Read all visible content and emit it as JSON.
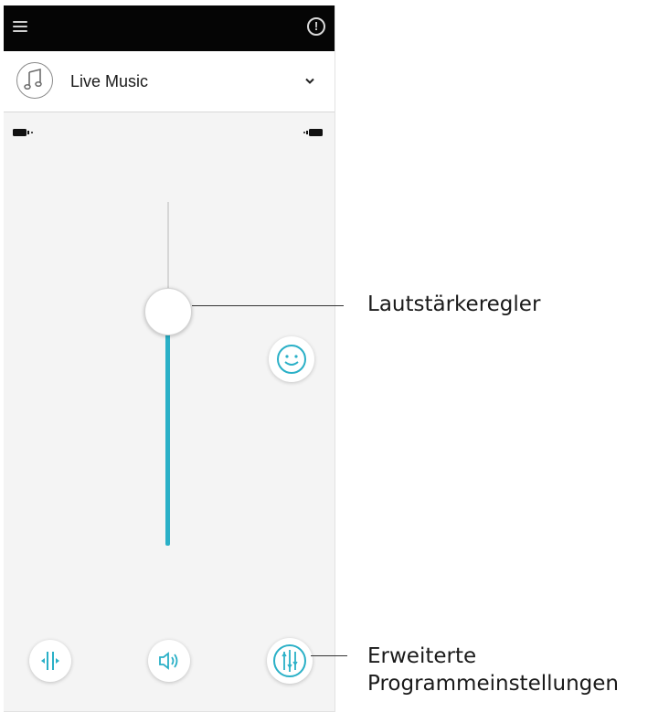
{
  "program": {
    "name": "Live Music"
  },
  "volume": {
    "level": 0.68
  },
  "icons": {
    "menu": "hamburger-menu-icon",
    "alert": "alert-icon",
    "program": "music-note-icon",
    "dropdown": "chevron-down-icon",
    "battery_left": "battery-left-icon",
    "battery_right": "battery-right-icon",
    "comfort": "smiley-icon",
    "balance": "balance-icon",
    "speaker": "speaker-icon",
    "equalizer": "equalizer-icon"
  },
  "colors": {
    "accent": "#2ab0c7",
    "statusbar": "#050505",
    "background": "#f4f4f4"
  },
  "callouts": {
    "volume_control": "Lautstärkeregler",
    "advanced_line1": "Erweiterte",
    "advanced_line2": "Programmeinstellungen"
  }
}
